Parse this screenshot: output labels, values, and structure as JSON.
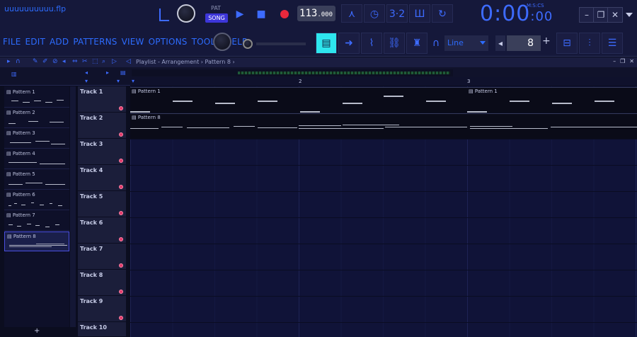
{
  "app": {
    "filename": "uuuuuuuuuu.flp",
    "menu": [
      "FILE",
      "EDIT",
      "ADD",
      "PATTERNS",
      "VIEW",
      "OPTIONS",
      "TOOLS",
      "HELP"
    ],
    "pat_label": "PAT",
    "song_label": "SONG",
    "tempo_main": "113",
    "tempo_frac": ".000",
    "time_display": "0:00",
    "time_small": ":00",
    "time_unit": "M:S:CS",
    "snap": "Line",
    "step": "8",
    "playlist_title": "Playlist - Arrangement › Pattern 8 ›",
    "win": {
      "minimize": "–",
      "restore": "❐",
      "close": "✕"
    }
  },
  "patterns": [
    {
      "label": "Pattern 1"
    },
    {
      "label": "Pattern 2"
    },
    {
      "label": "Pattern 3"
    },
    {
      "label": "Pattern 4"
    },
    {
      "label": "Pattern 5"
    },
    {
      "label": "Pattern 6"
    },
    {
      "label": "Pattern 7"
    },
    {
      "label": "Pattern 8",
      "selected": true
    }
  ],
  "tracks": [
    "Track 1",
    "Track 2",
    "Track 3",
    "Track 4",
    "Track 5",
    "Track 6",
    "Track 7",
    "Track 8",
    "Track 9",
    "Track 10"
  ],
  "timeline": {
    "bar2": "2",
    "bar3": "3"
  },
  "clips": {
    "c1": "Pattern 1",
    "c2": "Pattern 1",
    "c3": "Pattern 8"
  },
  "colors": {
    "accent": "#3d6bff",
    "active": "#2ee6ee",
    "record": "#e8283c",
    "song": "#3d36d9"
  }
}
